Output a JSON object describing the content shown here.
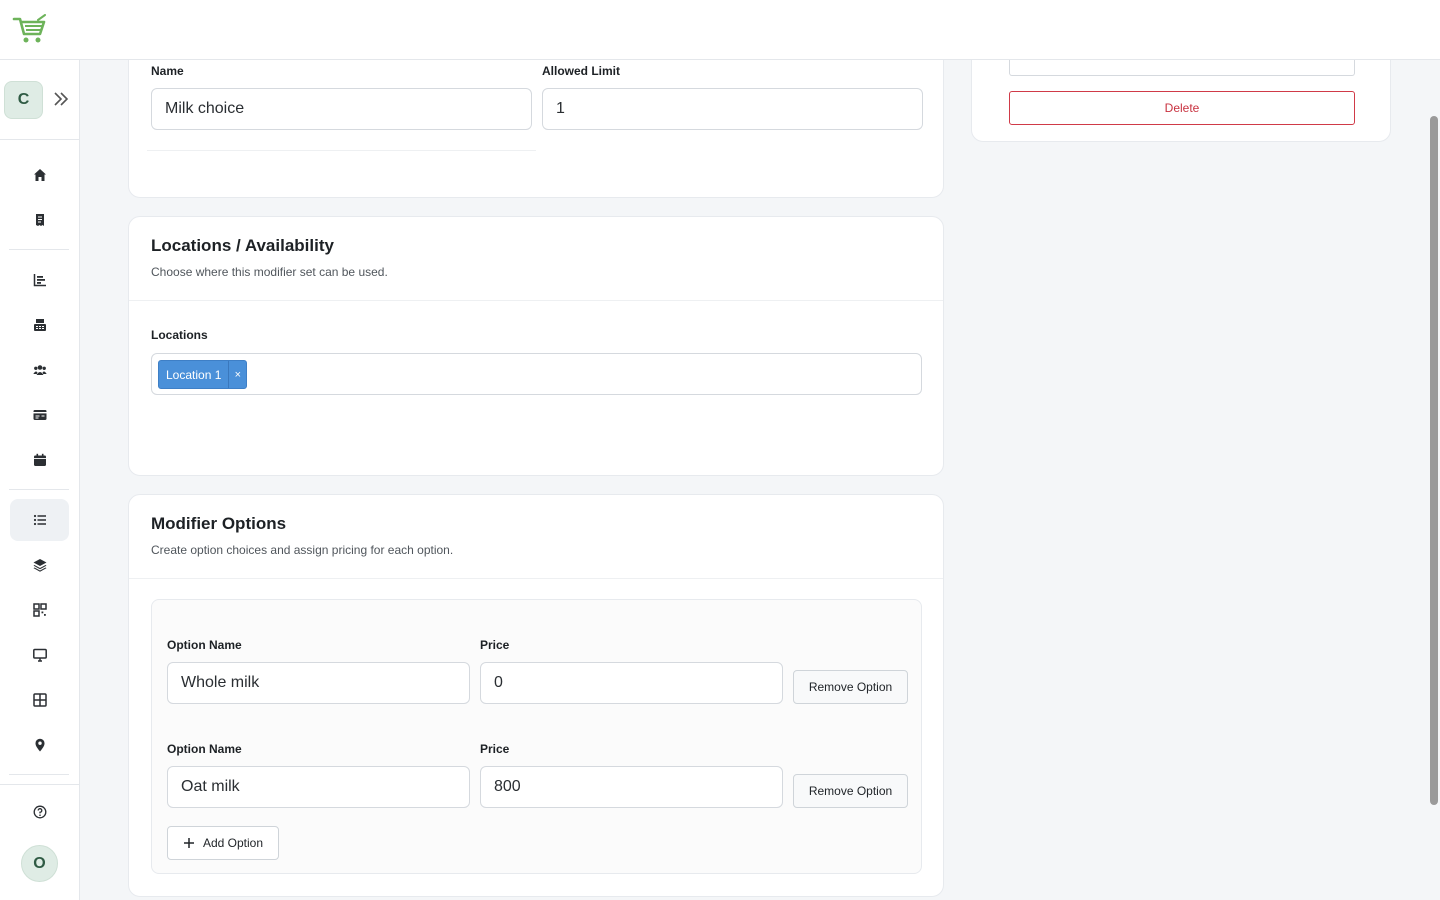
{
  "colors": {
    "brand_green": "#6db35a",
    "danger": "#c8313f",
    "tag_blue": "#4a90d9"
  },
  "topbar": {
    "logo_icon": "shopping-cart-icon"
  },
  "sidebar": {
    "org_initial": "C",
    "expand_icon": "double-chevron-right-icon",
    "items": [
      {
        "icon": "home-icon"
      },
      {
        "icon": "receipt-icon"
      },
      {
        "icon": "bar-chart-icon"
      },
      {
        "icon": "cash-register-icon"
      },
      {
        "icon": "users-icon"
      },
      {
        "icon": "id-card-icon"
      },
      {
        "icon": "calendar-icon"
      },
      {
        "icon": "list-icon",
        "active": true
      },
      {
        "icon": "layers-icon"
      },
      {
        "icon": "qr-code-icon"
      },
      {
        "icon": "monitor-icon"
      },
      {
        "icon": "grid-icon"
      },
      {
        "icon": "map-pin-icon"
      }
    ],
    "help_icon": "help-circle-icon",
    "user_initial": "O"
  },
  "general": {
    "name_label": "Name",
    "name_value": "Milk choice",
    "limit_label": "Allowed Limit",
    "limit_value": "1"
  },
  "locations": {
    "title": "Locations / Availability",
    "description": "Choose where this modifier set can be used.",
    "field_label": "Locations",
    "selected": [
      "Location 1"
    ],
    "remove_symbol": "×"
  },
  "modifier_options": {
    "title": "Modifier Options",
    "description": "Create option choices and assign pricing for each option.",
    "option_name_label": "Option Name",
    "price_label": "Price",
    "remove_label": "Remove Option",
    "options": [
      {
        "name": "Whole milk",
        "price": "0"
      },
      {
        "name": "Oat milk",
        "price": "800"
      }
    ],
    "add_label": "Add Option"
  },
  "actions": {
    "delete_label": "Delete"
  }
}
